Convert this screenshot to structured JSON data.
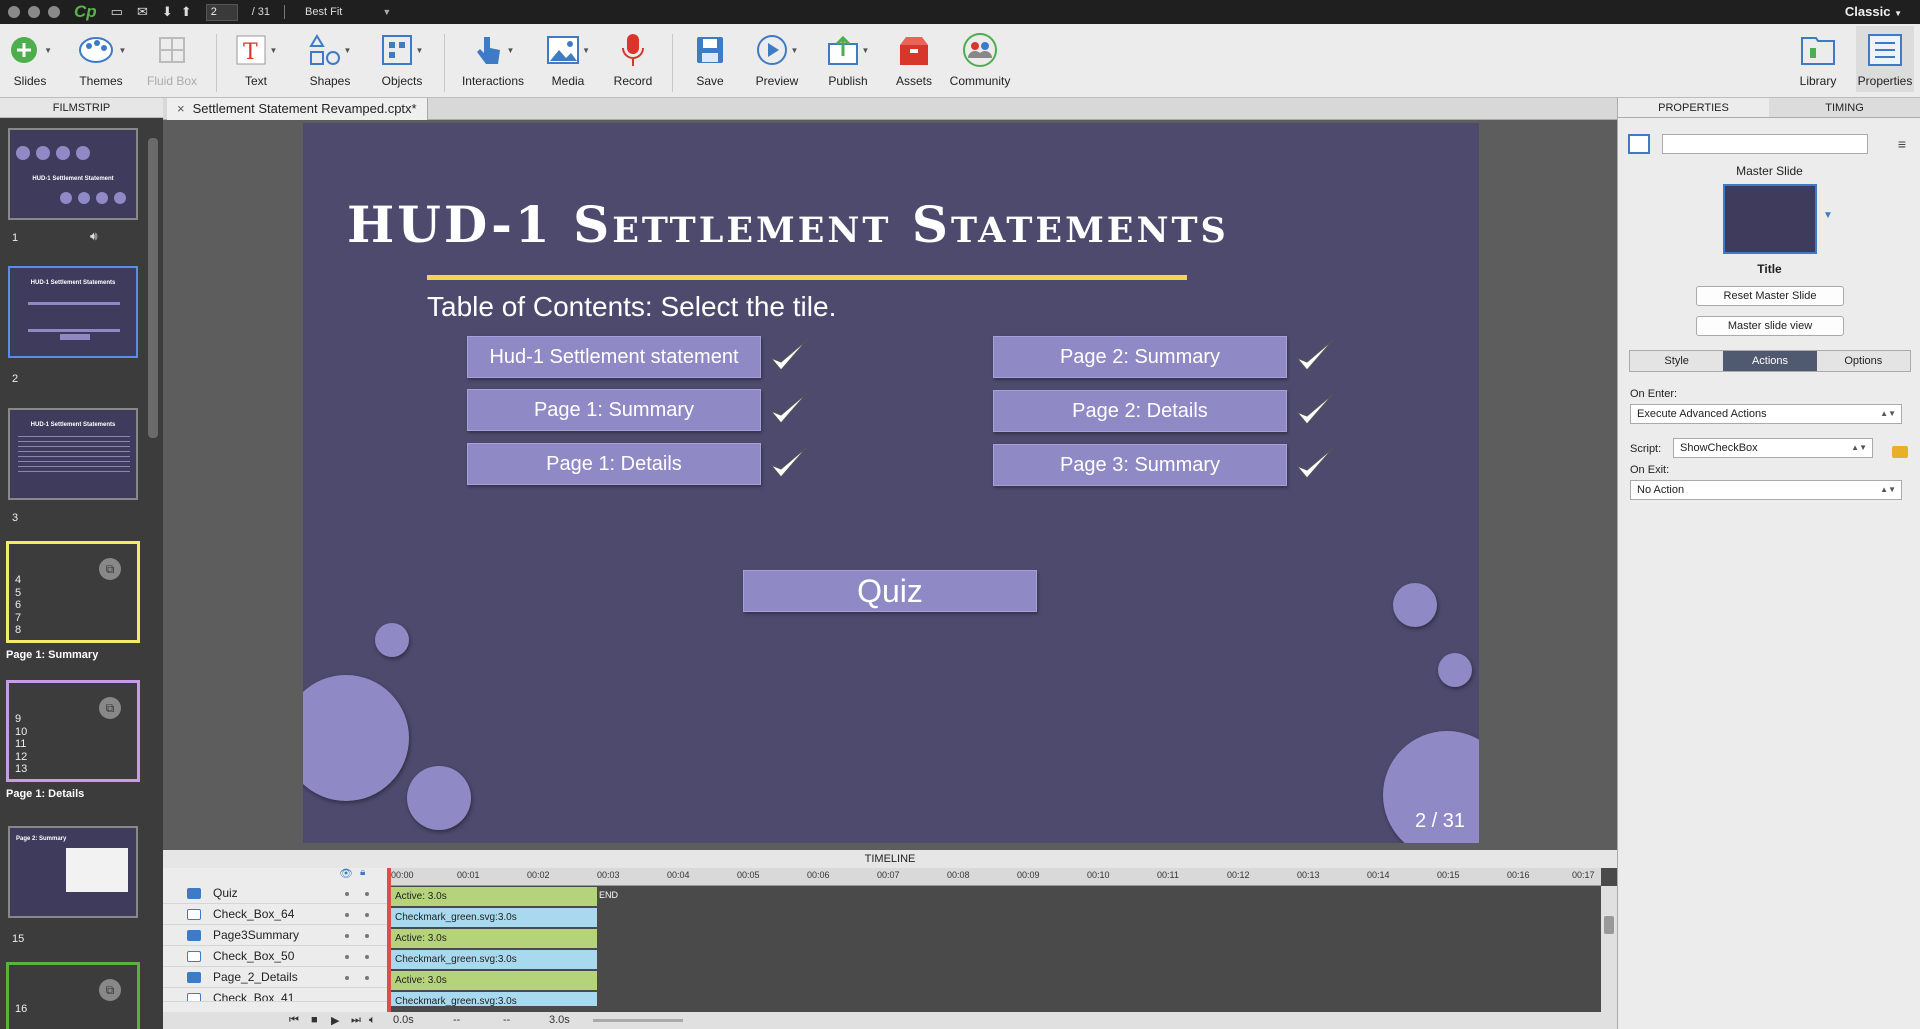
{
  "titlebar": {
    "app": "Cp",
    "page_current": "2",
    "page_total": "/ 31",
    "fit": "Best Fit",
    "workspace": "Classic"
  },
  "toolbar": {
    "slides": "Slides",
    "themes": "Themes",
    "fluid_box": "Fluid Box",
    "text": "Text",
    "shapes": "Shapes",
    "objects": "Objects",
    "interactions": "Interactions",
    "media": "Media",
    "record": "Record",
    "save": "Save",
    "preview": "Preview",
    "publish": "Publish",
    "assets": "Assets",
    "community": "Community",
    "library": "Library",
    "properties": "Properties"
  },
  "filmstrip": {
    "header": "FILMSTRIP",
    "thumb1_title": "HUD-1 Settlement Statement",
    "thumb2_title": "HUD-1 Settlement Statements",
    "thumb3_title": "HUD-1 Settlement Statements",
    "thumb5_title": "Page 2: Summary",
    "slide1": "1",
    "slide2": "2",
    "slide3": "3",
    "slide15": "15",
    "group1_nums": [
      "4",
      "5",
      "6",
      "7",
      "8"
    ],
    "group1_label": "Page 1: Summary",
    "group2_nums": [
      "9",
      "10",
      "11",
      "12",
      "13"
    ],
    "group2_label": "Page 1: Details",
    "group3_num": "16"
  },
  "document": {
    "tab_close": "×",
    "tab_title": "Settlement Statement Revamped.cptx*"
  },
  "slide": {
    "title": "HUD-1 Settlement Statements",
    "subtitle": "Table of Contents: Select the tile.",
    "buttons_left": [
      "Hud-1 Settlement statement",
      "Page 1: Summary",
      "Page 1: Details"
    ],
    "buttons_right": [
      "Page 2: Summary",
      "Page 2: Details",
      "Page 3: Summary"
    ],
    "quiz": "Quiz",
    "counter": "2 / 31"
  },
  "timeline": {
    "header": "TIMELINE",
    "ticks": [
      "00:00",
      "00:01",
      "00:02",
      "00:03",
      "00:04",
      "00:05",
      "00:06",
      "00:07",
      "00:08",
      "00:09",
      "00:10",
      "00:11",
      "00:12",
      "00:13",
      "00:14",
      "00:15",
      "00:16",
      "00:17"
    ],
    "rows": [
      {
        "name": "Quiz",
        "bar": "Active: 3.0s"
      },
      {
        "name": "Check_Box_64",
        "bar": "Checkmark_green.svg:3.0s"
      },
      {
        "name": "Page3Summary",
        "bar": "Active: 3.0s"
      },
      {
        "name": "Check_Box_50",
        "bar": "Checkmark_green.svg:3.0s"
      },
      {
        "name": "Page_2_Details",
        "bar": "Active: 3.0s"
      },
      {
        "name": "Check_Box_41",
        "bar": "Checkmark_green.svg:3.0s"
      }
    ],
    "end_label": "END",
    "time_start": "0.0s",
    "time_sel": "--",
    "time_dur": "--",
    "time_total": "3.0s"
  },
  "properties": {
    "tab_properties": "PROPERTIES",
    "tab_timing": "TIMING",
    "master_label": "Master Slide",
    "master_name": "Title",
    "reset_button": "Reset Master Slide",
    "view_button": "Master slide view",
    "subtab_style": "Style",
    "subtab_actions": "Actions",
    "subtab_options": "Options",
    "on_enter_label": "On Enter:",
    "on_enter_value": "Execute Advanced Actions",
    "script_label": "Script:",
    "script_value": "ShowCheckBox",
    "on_exit_label": "On Exit:",
    "on_exit_value": "No Action"
  },
  "colors": {
    "slide_bg": "#4e4a6e",
    "tile": "#8f8ac6",
    "title_rule": "#f3d35a",
    "group1_border": "#f2ec6a",
    "group2_border": "#c89be8",
    "group3_border": "#5ab23b",
    "active_thumb_border": "#5b8de8"
  }
}
